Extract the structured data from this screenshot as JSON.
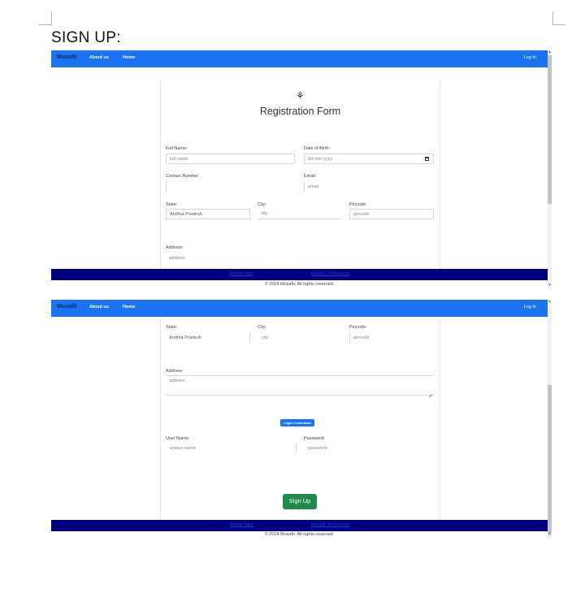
{
  "document": {
    "heading": "SIGN UP:"
  },
  "nav": {
    "brand": "Musafir",
    "about": "About us",
    "home": "Home",
    "login": "Log In"
  },
  "form": {
    "title": "Registration Form",
    "logo_icon": "globe-icon",
    "full_name": {
      "label": "Full Name:",
      "placeholder": "full name"
    },
    "dob": {
      "label": "Date of Birth:",
      "placeholder": "dd-mm-yyyy"
    },
    "contact": {
      "label": "Contact Number:"
    },
    "email": {
      "label": "Email:",
      "placeholder": "email"
    },
    "state": {
      "label": "State:",
      "value": "Andhra Pradesh"
    },
    "city": {
      "label": "City:",
      "placeholder": "city"
    },
    "pincode": {
      "label": "Pincode:",
      "placeholder": "pincode"
    },
    "address": {
      "label": "Address:",
      "placeholder": "address"
    },
    "login_credentials_button": "Login Credentials",
    "username": {
      "label": "User Name:",
      "placeholder": "unique name"
    },
    "password": {
      "label": "Password:",
      "placeholder": "password"
    },
    "signup_button": "Sign Up"
  },
  "footer": {
    "admin_login": "Admin login",
    "musafir_technocrat": "Musafir Technocrat",
    "copyright": "© 2024 Musafir. All rights reserved."
  }
}
